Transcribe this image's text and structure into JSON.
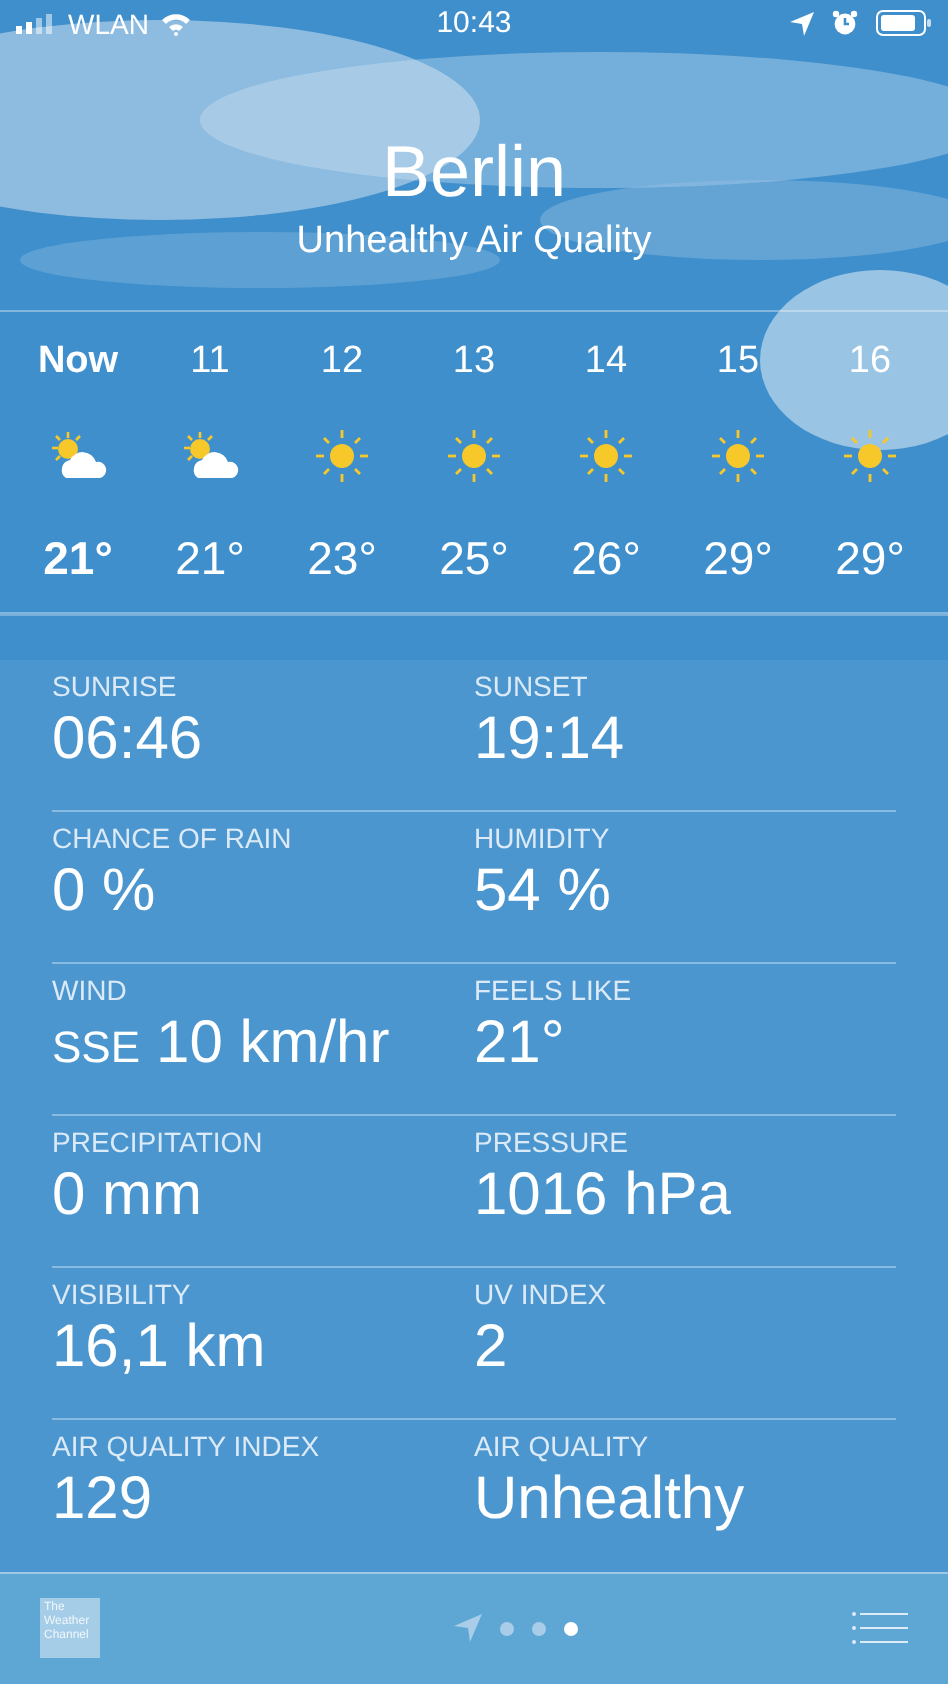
{
  "status_bar": {
    "carrier": "WLAN",
    "time": "10:43"
  },
  "header": {
    "city": "Berlin",
    "condition": "Unhealthy Air Quality"
  },
  "hourly": [
    {
      "time": "Now",
      "kind": "partly-cloudy",
      "temp": "21°",
      "now": true
    },
    {
      "time": "11",
      "kind": "partly-cloudy",
      "temp": "21°",
      "now": false
    },
    {
      "time": "12",
      "kind": "sunny",
      "temp": "23°",
      "now": false
    },
    {
      "time": "13",
      "kind": "sunny",
      "temp": "25°",
      "now": false
    },
    {
      "time": "14",
      "kind": "sunny",
      "temp": "26°",
      "now": false
    },
    {
      "time": "15",
      "kind": "sunny",
      "temp": "29°",
      "now": false
    },
    {
      "time": "16",
      "kind": "sunny",
      "temp": "29°",
      "now": false
    }
  ],
  "details": [
    {
      "label": "SUNRISE",
      "value": "06:46"
    },
    {
      "label": "SUNSET",
      "value": "19:14"
    },
    {
      "label": "CHANCE OF RAIN",
      "value": "0 %"
    },
    {
      "label": "HUMIDITY",
      "value": "54 %"
    },
    {
      "label": "WIND",
      "direction": "SSE",
      "value": "10 km/hr"
    },
    {
      "label": "FEELS LIKE",
      "value": "21°"
    },
    {
      "label": "PRECIPITATION",
      "value": "0 mm"
    },
    {
      "label": "PRESSURE",
      "value": "1016 hPa"
    },
    {
      "label": "VISIBILITY",
      "value": "16,1 km"
    },
    {
      "label": "UV INDEX",
      "value": "2"
    },
    {
      "label": "AIR QUALITY INDEX",
      "value": "129"
    },
    {
      "label": "AIR QUALITY",
      "value": "Unhealthy"
    }
  ],
  "bottom_bar": {
    "logo": "The Weather Channel",
    "pages": [
      {
        "kind": "location",
        "selected": false
      },
      {
        "kind": "dot",
        "selected": false
      },
      {
        "kind": "dot",
        "selected": false
      },
      {
        "kind": "dot",
        "selected": true
      }
    ]
  }
}
